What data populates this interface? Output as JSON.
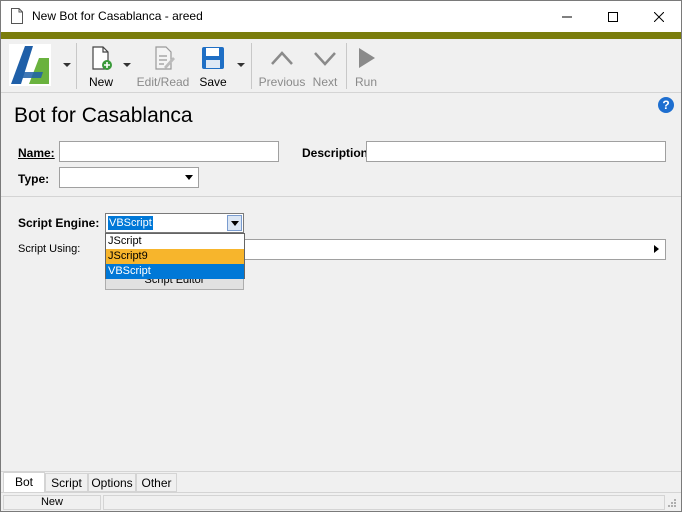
{
  "window": {
    "title": "New Bot for Casablanca - areed",
    "accent_color": "#7a7d0c"
  },
  "toolbar": {
    "logo_icon": "app-logo",
    "buttons": [
      {
        "label": "New",
        "icon": "new-document-icon",
        "enabled": true
      },
      {
        "label": "Edit/Read",
        "icon": "edit-read-icon",
        "enabled": false
      },
      {
        "label": "Save",
        "icon": "save-icon",
        "enabled": true
      },
      {
        "label": "Previous",
        "icon": "chevron-up-icon",
        "enabled": false
      },
      {
        "label": "Next",
        "icon": "chevron-down-icon",
        "enabled": false
      },
      {
        "label": "Run",
        "icon": "play-icon",
        "enabled": false
      }
    ]
  },
  "form": {
    "title": "Bot for Casablanca",
    "name_label": "Name:",
    "name_value": "",
    "description_label": "Description:",
    "description_value": "",
    "type_label": "Type:",
    "type_value": ""
  },
  "script": {
    "engine_label": "Script Engine:",
    "engine_value": "VBScript",
    "engine_options": [
      "JScript",
      "JScript9",
      "VBScript"
    ],
    "using_label": "Script Using:",
    "editor_button": "Script Editor"
  },
  "tabs": [
    "Bot",
    "Script",
    "Options",
    "Other"
  ],
  "active_tab": "Bot",
  "status": {
    "mode": "New"
  },
  "colors": {
    "highlight": "#f7b52c",
    "selected": "#0078d7",
    "help": "#1e6fd0"
  }
}
